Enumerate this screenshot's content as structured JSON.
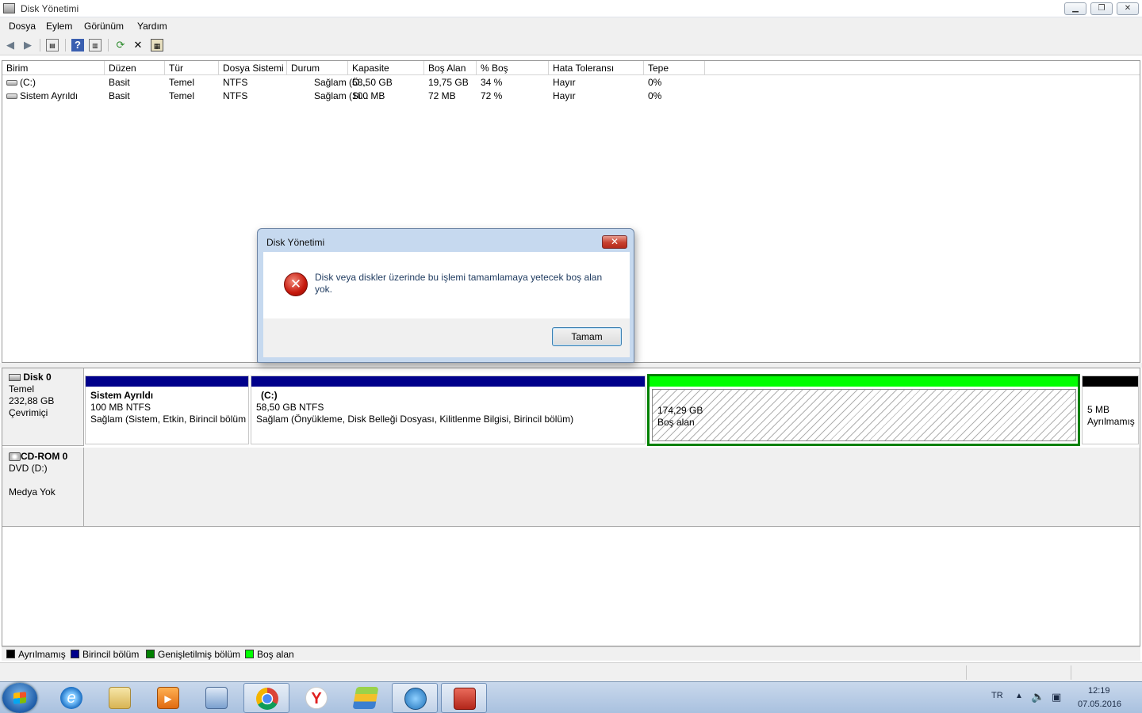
{
  "window": {
    "title": "Disk Yönetimi",
    "controls": [
      "minimize",
      "maximize",
      "close"
    ]
  },
  "menu": [
    "Dosya",
    "Eylem",
    "Görünüm",
    "Yardım"
  ],
  "toolbar_icons": [
    "back-arrow-icon",
    "forward-arrow-icon",
    "console-tree-icon",
    "help-icon",
    "properties-icon",
    "refresh-icon",
    "delete-icon",
    "rescan-icon"
  ],
  "volume_table": {
    "columns": [
      "Birim",
      "Düzen",
      "Tür",
      "Dosya Sistemi",
      "Durum",
      "Kapasite",
      "Boş Alan",
      "% Boş",
      "Hata Toleransı",
      "Tepe"
    ],
    "rows": [
      [
        "(C:)",
        "Basit",
        "Temel",
        "NTFS",
        "Sağlam (Ö...",
        "58,50 GB",
        "19,75 GB",
        "34 %",
        "Hayır",
        "0%"
      ],
      [
        "Sistem Ayrıldı",
        "Basit",
        "Temel",
        "NTFS",
        "Sağlam (Si...",
        "100 MB",
        "72 MB",
        "72 %",
        "Hayır",
        "0%"
      ]
    ]
  },
  "disks": [
    {
      "name": "Disk 0",
      "type": "Temel",
      "size": "232,88 GB",
      "status": "Çevrimiçi",
      "partitions": [
        {
          "title": "Sistem Ayrıldı",
          "size": "100 MB NTFS",
          "status": "Sağlam (Sistem, Etkin, Birincil bölüm",
          "bar_color": "#00008b"
        },
        {
          "title": "(C:)",
          "size": "58,50 GB NTFS",
          "status": "Sağlam (Önyükleme, Disk Belleği Dosyası, Kilitlenme Bilgisi, Birincil bölüm)",
          "bar_color": "#00008b"
        },
        {
          "size": "174,29 GB",
          "status": "Boş alan",
          "bar_color": "#00ff00"
        },
        {
          "size": "5 MB",
          "status": "Ayrılmamış",
          "bar_color": "#000000"
        }
      ]
    },
    {
      "name": "CD-ROM 0",
      "type": "DVD (D:)",
      "status": "Medya Yok"
    }
  ],
  "legend": [
    {
      "label": "Ayrılmamış",
      "color": "#000000"
    },
    {
      "label": "Birincil bölüm",
      "color": "#00008b"
    },
    {
      "label": "Genişletilmiş bölüm",
      "color": "#008000"
    },
    {
      "label": "Boş alan",
      "color": "#00ff00"
    }
  ],
  "dialog": {
    "title": "Disk Yönetimi",
    "message": "Disk veya diskler üzerinde bu işlemi tamamlamaya yetecek boş alan yok.",
    "ok_label": "Tamam",
    "icon": "error-icon"
  },
  "taskbar": {
    "apps": [
      "internet-explorer-icon",
      "file-explorer-icon",
      "media-player-icon",
      "control-panel-icon",
      "chrome-icon",
      "yandex-icon",
      "bluestacks-icon",
      "network-icon",
      "toolbox-icon"
    ],
    "language": "TR",
    "time": "12:19",
    "date": "07.05.2016"
  }
}
